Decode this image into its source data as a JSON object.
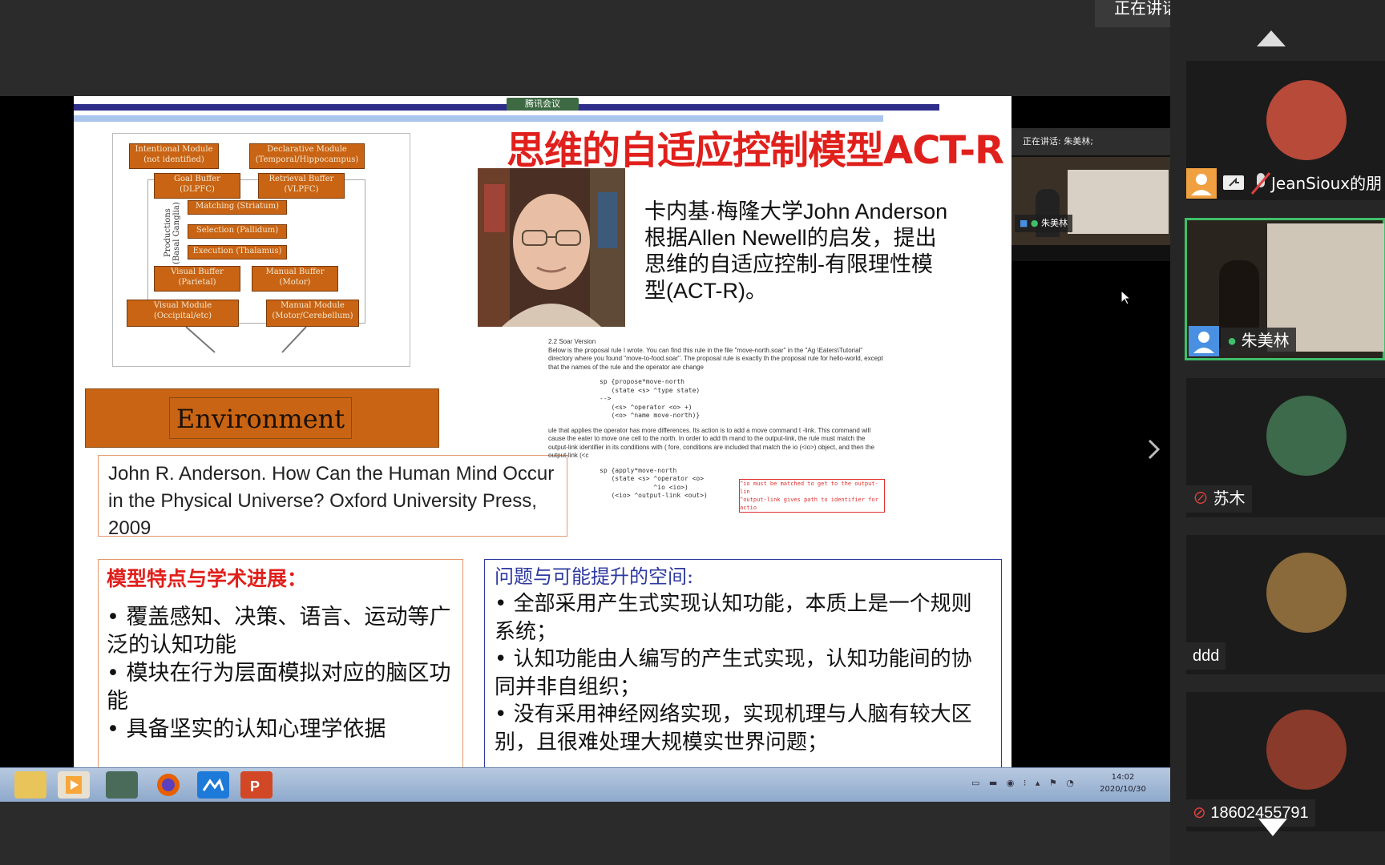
{
  "top_speaking": "正在讲话: 朱美林;",
  "slide": {
    "mini_label": "腾讯会议",
    "title": "思维的自适应控制模型ACT-R",
    "diagram": {
      "intentional": [
        "Intentional Module",
        "(not identified)"
      ],
      "declarative": [
        "Declarative Module",
        "(Temporal/Hippocampus)"
      ],
      "goal": [
        "Goal Buffer",
        "(DLPFC)"
      ],
      "retrieval": [
        "Retrieval Buffer",
        "(VLPFC)"
      ],
      "matching": "Matching (Striatum)",
      "selection": "Selection (Pallidum)",
      "execution": "Execution (Thalamus)",
      "productions": "Productions (Basal Ganglia)",
      "visual_buffer": [
        "Visual Buffer",
        "(Parietal)"
      ],
      "manual_buffer": [
        "Manual Buffer",
        "(Motor)"
      ],
      "visual_module": [
        "Visual Module",
        "(Occipital/etc)"
      ],
      "manual_module": [
        "Manual Module",
        "(Motor/Cerebellum)"
      ],
      "environment": "Environment"
    },
    "citation": "John R. Anderson. How Can the Human Mind Occur in the Physical Universe? Oxford University Press, 2009",
    "author_desc": "卡内基·梅隆大学John Anderson根据Allen Newell的启发，提出思维的自适应控制-有限理性模型(ACT-R)。",
    "soar": {
      "heading": "2.2 Soar Version",
      "p1": "Below is the proposal rule I wrote. You can find this rule in the file \"move-north.soar\" in the \"Ag \\Eaters\\Tutorial\" directory where you found \"move-to-food.soar\". The proposal rule is exactly th the proposal rule for hello-world, except that the names of the rule and the operator are change",
      "code1": "sp {propose*move-north\n   (state <s> ^type state)\n-->\n   (<s> ^operator <o> +)\n   (<o> ^name move-north)}",
      "p2": "ule that applies the operator has more differences. Its action is to add a move command t -link. This command will cause the eater to move one cell to the north. In order to add th mand to the output-link, the rule must match the output-link identifier in its conditions with ( fore, conditions are included that match the io (<io>) object, and then the output-link (<c",
      "code2": "sp {apply*move-north\n   (state <s> ^operator <o>\n              ^io <io>)\n   (<io> ^output-link <out>)",
      "note1": "^io must be matched to get to the output-lin",
      "note2": "^output-link gives path to identifier for actio"
    },
    "features": {
      "heading": "模型特点与学术进展：",
      "items": [
        "• 覆盖感知、决策、语言、运动等广泛的认知功能",
        "• 模块在行为层面模拟对应的脑区功能",
        "• 具备坚实的认知心理学依据"
      ]
    },
    "issues": {
      "heading": "问题与可能提升的空间:",
      "items": [
        "•  全部采用产生式实现认知功能，本质上是一个规则系统；",
        "• 认知功能由人编写的产生式实现，认知功能间的协同并非自组织；",
        "• 没有采用神经网络实现，实现机理与人脑有较大区别，且很难处理大规模实世界问题；"
      ]
    }
  },
  "thumb": {
    "speaking": "正在讲话: 朱美林;",
    "name": "朱美林"
  },
  "participants": [
    {
      "name": "JeanSioux的朋"
    },
    {
      "name": "朱美林"
    },
    {
      "name": "苏木"
    },
    {
      "name": "ddd"
    },
    {
      "name": "18602455791"
    }
  ],
  "taskbar": {
    "time": "14:02",
    "date": "2020/10/30"
  },
  "colors": {
    "slide_title": "#e0201c",
    "module_fill": "#c86414",
    "active_speaker_border": "#3fbf6a"
  }
}
